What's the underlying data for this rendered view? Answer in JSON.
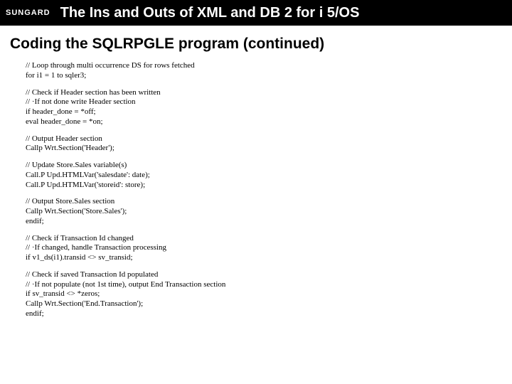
{
  "header": {
    "logo_text": "SUNGARD",
    "title": "The Ins and Outs of XML and DB 2 for i 5/OS"
  },
  "section_title": "Coding the SQLRPGLE program (continued)",
  "blocks": [
    {
      "lines": [
        "// Loop through multi occurrence DS for rows fetched",
        "  for i1 = 1 to sqler3;"
      ]
    },
    {
      "lines": [
        "// Check if Header section has been written",
        "// ·If not done write Header section",
        "  if  header_done = *off;",
        "    eval header_done = *on;"
      ]
    },
    {
      "lines": [
        "// Output Header section",
        "    Callp Wrt.Section('Header');"
      ]
    },
    {
      "lines": [
        "// Update Store.Sales variable(s)",
        "    Call.P Upd.HTMLVar('salesdate': date);",
        "    Call.P Upd.HTMLVar('storeid': store);"
      ]
    },
    {
      "lines": [
        "// Output Store.Sales section",
        "    Callp Wrt.Section('Store.Sales');",
        "  endif;"
      ]
    },
    {
      "lines": [
        "// Check if Transaction Id changed",
        "// ·If changed, handle Transaction processing",
        "  if  v1_ds(i1).transid <> sv_transid;"
      ]
    },
    {
      "lines": [
        "// Check if saved Transaction Id populated",
        "// ·If not populate (not 1st time), output End Transaction section",
        "  if sv_transid <> *zeros;",
        "    Callp Wrt.Section('End.Transaction');",
        "  endif;"
      ]
    }
  ]
}
